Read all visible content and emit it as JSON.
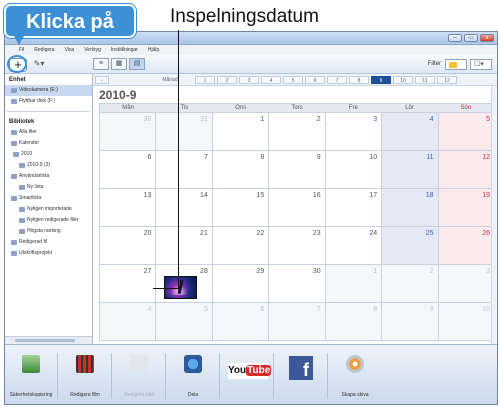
{
  "annotations": {
    "callout": "Klicka på",
    "date_label": "Inspelningsdatum"
  },
  "window": {
    "title": "Everio MediaBrowser",
    "controls": [
      "–",
      "▭",
      "x"
    ]
  },
  "menu": [
    "Fil",
    "Redigera",
    "Visa",
    "Verktyg",
    "Inställningar",
    "Hjälp"
  ],
  "toolbar": {
    "add": "+",
    "tool2": "✎▾",
    "filter_label": "Filter"
  },
  "sidebar": {
    "device_header": "Enhet",
    "device_items": [
      "Videokamera (E:)",
      "Flyttbar disk (F:)"
    ],
    "library_header": "Bibliotek",
    "library_items": [
      {
        "label": "Alla filer",
        "level": 0
      },
      {
        "label": "Kalender",
        "level": 0
      },
      {
        "label": "2010",
        "level": 1
      },
      {
        "label": "2010-9 (3)",
        "level": 2
      },
      {
        "label": "Användarlista",
        "level": 0
      },
      {
        "label": "Ny lista",
        "level": 2
      },
      {
        "label": "Smartlista",
        "level": 0
      },
      {
        "label": "Nyligen importerade",
        "level": 2
      },
      {
        "label": "Nyligen redigerade filer",
        "level": 2
      },
      {
        "label": "Högsta ranking",
        "level": 2
      },
      {
        "label": "Redigerad fil",
        "level": 0
      },
      {
        "label": "Utskriftsprojekt",
        "level": 0
      }
    ]
  },
  "monthnav": {
    "year_label": "Månad",
    "months": [
      "1",
      "2",
      "3",
      "4",
      "5",
      "6",
      "7",
      "8",
      "9",
      "10",
      "11",
      "12"
    ],
    "selected": "9"
  },
  "calendar": {
    "month_title": "2010-9",
    "days": [
      "Mån",
      "Tis",
      "Ons",
      "Tors",
      "Fre",
      "Lör",
      "Sön"
    ],
    "weeks": [
      [
        [
          "30",
          true
        ],
        [
          "31",
          true
        ],
        [
          "1",
          false
        ],
        [
          "2",
          false
        ],
        [
          "3",
          false
        ],
        [
          "4",
          false
        ],
        [
          "5",
          false
        ]
      ],
      [
        [
          "6",
          false
        ],
        [
          "7",
          false
        ],
        [
          "8",
          false
        ],
        [
          "9",
          false
        ],
        [
          "10",
          false
        ],
        [
          "11",
          false
        ],
        [
          "12",
          false
        ]
      ],
      [
        [
          "13",
          false
        ],
        [
          "14",
          false
        ],
        [
          "15",
          false
        ],
        [
          "16",
          false
        ],
        [
          "17",
          false
        ],
        [
          "18",
          false
        ],
        [
          "19",
          false
        ]
      ],
      [
        [
          "20",
          false
        ],
        [
          "21",
          false
        ],
        [
          "22",
          false
        ],
        [
          "23",
          false
        ],
        [
          "24",
          false
        ],
        [
          "25",
          false
        ],
        [
          "26",
          false
        ]
      ],
      [
        [
          "27",
          false
        ],
        [
          "28",
          false
        ],
        [
          "29",
          false
        ],
        [
          "30",
          false
        ],
        [
          "1",
          true
        ],
        [
          "2",
          true
        ],
        [
          "3",
          true
        ]
      ],
      [
        [
          "4",
          true
        ],
        [
          "5",
          true
        ],
        [
          "6",
          true
        ],
        [
          "7",
          true
        ],
        [
          "8",
          true
        ],
        [
          "9",
          true
        ],
        [
          "10",
          true
        ]
      ]
    ]
  },
  "bottom_bar": [
    {
      "label": "Säkerhetskopiering",
      "icon": "import-icon",
      "enabled": true
    },
    {
      "label": "Redigera film",
      "icon": "film-edit-icon",
      "enabled": true
    },
    {
      "label": "Redigera bild",
      "icon": "image-edit-icon",
      "enabled": false
    },
    {
      "label": "Dela",
      "icon": "web-icon",
      "enabled": true
    },
    {
      "label": "YouTube",
      "icon": "youtube-logo",
      "enabled": true
    },
    {
      "label": "Facebook",
      "icon": "facebook-logo",
      "enabled": true
    },
    {
      "label": "Skapa skiva",
      "icon": "disc-icon",
      "enabled": true
    }
  ]
}
